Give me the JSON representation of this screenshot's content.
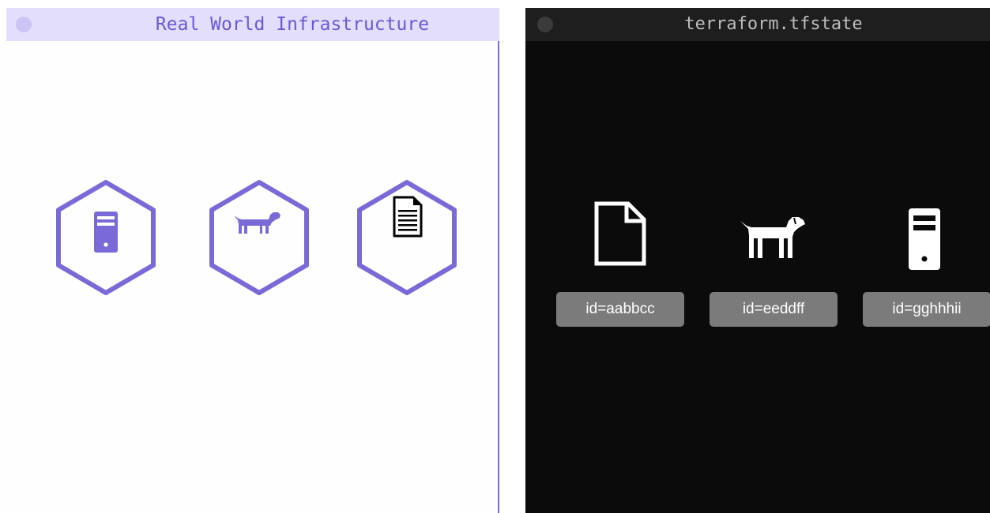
{
  "real_world_window": {
    "title": "Real World Infrastructure",
    "resources": [
      {
        "icon": "server-icon"
      },
      {
        "icon": "dog-icon"
      },
      {
        "icon": "document-icon"
      }
    ]
  },
  "state_window": {
    "title": "terraform.tfstate",
    "resources": [
      {
        "icon": "document-icon",
        "id_label": "id=aabbcc"
      },
      {
        "icon": "dog-icon",
        "id_label": "id=eeddff"
      },
      {
        "icon": "server-icon",
        "id_label": "id=gghhhii"
      }
    ]
  },
  "colors": {
    "accent_purple": "#7a6ad8",
    "left_titlebar": "#e3defb",
    "right_background": "#0b0b0b",
    "badge_gray": "#7b7b7b"
  }
}
